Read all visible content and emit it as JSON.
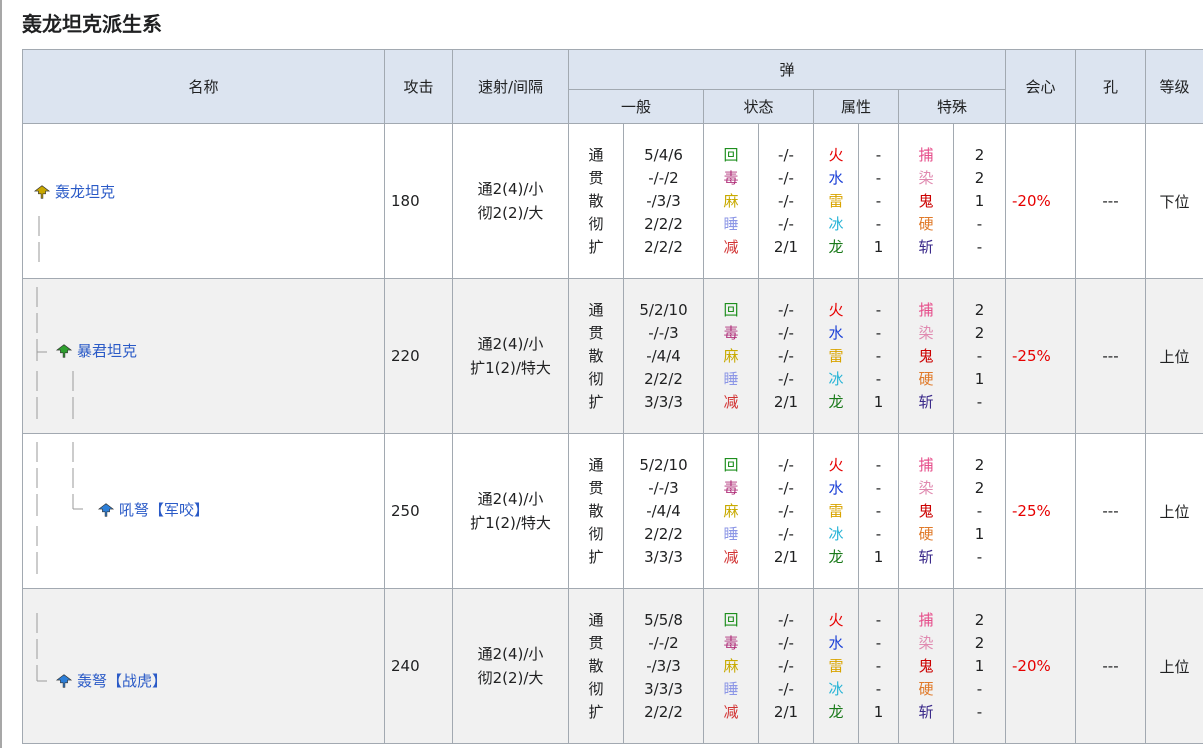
{
  "title": "轰龙坦克派生系",
  "headers": {
    "name": "名称",
    "attack": "攻击",
    "rapid": "速射/间隔",
    "ammo": "弹",
    "general": "一般",
    "status": "状态",
    "element": "属性",
    "special": "特殊",
    "affinity": "会心",
    "slots": "孔",
    "rank": "等级"
  },
  "colors": {
    "header_bg": "#dce4f0",
    "border": "#a2a9b1",
    "link": "#2a5ac7",
    "affinity_negative": "#e60000",
    "status_recovery": "#1e8f1e",
    "status_poison": "#b0307a",
    "status_paralysis": "#c8aa00",
    "status_sleep": "#8c96e6",
    "status_exhaust": "#d23232",
    "element_fire": "#e60000",
    "element_water": "#1a3fd6",
    "element_thunder": "#d9a400",
    "element_ice": "#28b4d6",
    "element_dragon": "#1a7a1a",
    "special_capture": "#e64d8a",
    "special_paint": "#e08ab0",
    "special_demon": "#cc0000",
    "special_armor": "#e07a2a",
    "special_slash": "#3a2a8a"
  },
  "ammo_types": {
    "general": [
      "通",
      "贯",
      "散",
      "彻",
      "扩"
    ],
    "status": [
      "回",
      "毒",
      "麻",
      "睡",
      "减"
    ],
    "element": [
      "火",
      "水",
      "雷",
      "冰",
      "龙"
    ],
    "special": [
      "捕",
      "染",
      "鬼",
      "硬",
      "斩"
    ]
  },
  "weapons": [
    {
      "name": "轰龙坦克",
      "icon": "bowgun-icon-yellow",
      "attack": "180",
      "rapid": [
        "通2(4)/小",
        "彻2(2)/大"
      ],
      "general": [
        "5/4/6",
        "-/-/2",
        "-/3/3",
        "2/2/2",
        "2/2/2"
      ],
      "status": [
        "-/-",
        "-/-",
        "-/-",
        "-/-",
        "2/1"
      ],
      "element": [
        "-",
        "-",
        "-",
        "-",
        "1"
      ],
      "special": [
        "2",
        "2",
        "1",
        "-",
        "-"
      ],
      "affinity": "-20%",
      "slots": "---",
      "rank": "下位"
    },
    {
      "name": "暴君坦克",
      "icon": "bowgun-icon-green",
      "attack": "220",
      "rapid": [
        "通2(4)/小",
        "扩1(2)/特大"
      ],
      "general": [
        "5/2/10",
        "-/-/3",
        "-/4/4",
        "2/2/2",
        "3/3/3"
      ],
      "status": [
        "-/-",
        "-/-",
        "-/-",
        "-/-",
        "2/1"
      ],
      "element": [
        "-",
        "-",
        "-",
        "-",
        "1"
      ],
      "special": [
        "2",
        "2",
        "-",
        "1",
        "-"
      ],
      "affinity": "-25%",
      "slots": "---",
      "rank": "上位"
    },
    {
      "name": "吼弩【军咬】",
      "icon": "bowgun-icon-blue",
      "attack": "250",
      "rapid": [
        "通2(4)/小",
        "扩1(2)/特大"
      ],
      "general": [
        "5/2/10",
        "-/-/3",
        "-/4/4",
        "2/2/2",
        "3/3/3"
      ],
      "status": [
        "-/-",
        "-/-",
        "-/-",
        "-/-",
        "2/1"
      ],
      "element": [
        "-",
        "-",
        "-",
        "-",
        "1"
      ],
      "special": [
        "2",
        "2",
        "-",
        "1",
        "-"
      ],
      "affinity": "-25%",
      "slots": "---",
      "rank": "上位"
    },
    {
      "name": "轰弩【战虎】",
      "icon": "bowgun-icon-blue",
      "attack": "240",
      "rapid": [
        "通2(4)/小",
        "彻2(2)/大"
      ],
      "general": [
        "5/5/8",
        "-/-/2",
        "-/3/3",
        "3/3/3",
        "2/2/2"
      ],
      "status": [
        "-/-",
        "-/-",
        "-/-",
        "-/-",
        "2/1"
      ],
      "element": [
        "-",
        "-",
        "-",
        "-",
        "1"
      ],
      "special": [
        "2",
        "2",
        "1",
        "-",
        "-"
      ],
      "affinity": "-20%",
      "slots": "---",
      "rank": "上位"
    }
  ]
}
